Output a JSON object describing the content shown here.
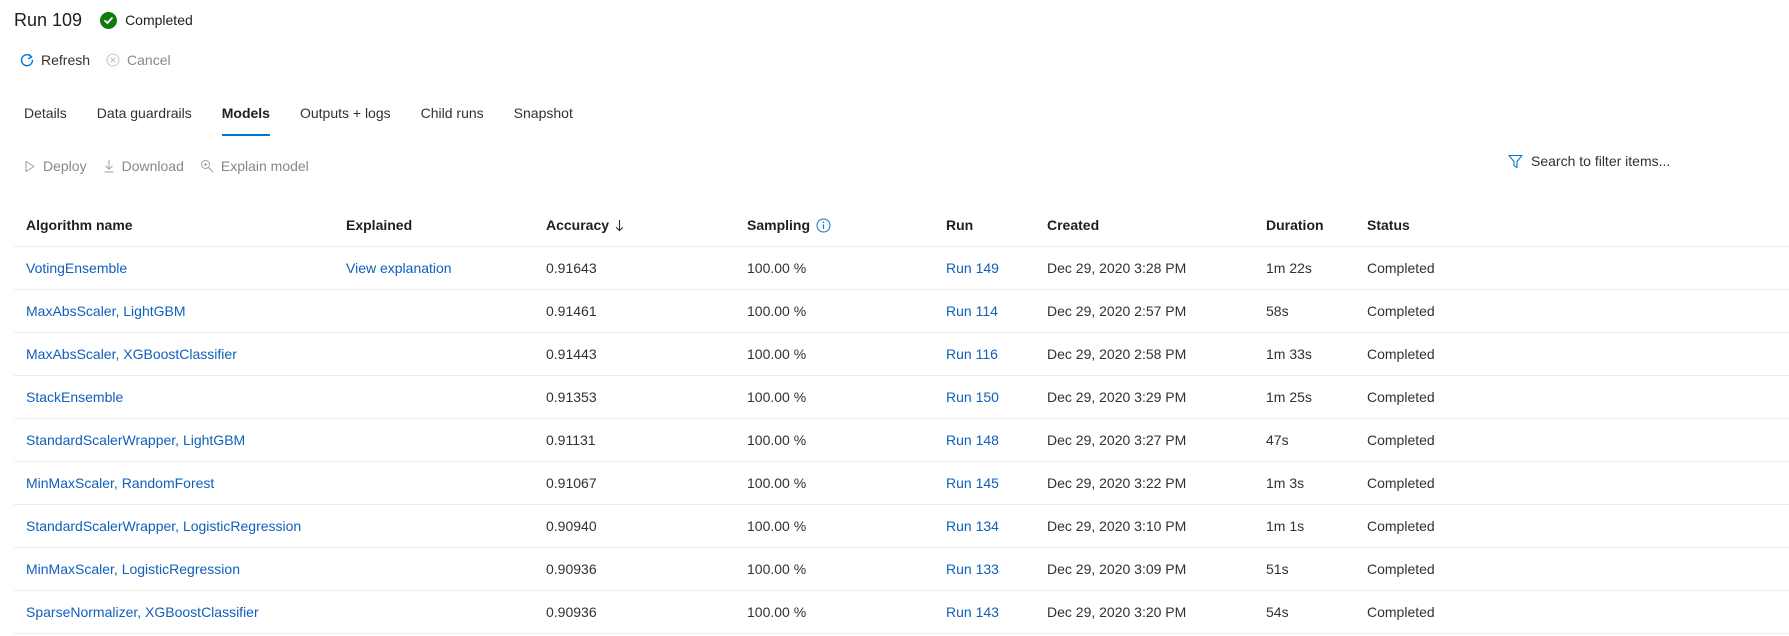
{
  "header": {
    "title": "Run 109",
    "status": "Completed"
  },
  "commands": {
    "refresh": "Refresh",
    "cancel": "Cancel"
  },
  "tabs": [
    {
      "label": "Details",
      "active": false
    },
    {
      "label": "Data guardrails",
      "active": false
    },
    {
      "label": "Models",
      "active": true
    },
    {
      "label": "Outputs + logs",
      "active": false
    },
    {
      "label": "Child runs",
      "active": false
    },
    {
      "label": "Snapshot",
      "active": false
    }
  ],
  "toolbar": {
    "deploy": "Deploy",
    "download": "Download",
    "explain": "Explain model"
  },
  "search": {
    "placeholder": "Search to filter items..."
  },
  "table": {
    "columns": {
      "algorithm": "Algorithm name",
      "explained": "Explained",
      "accuracy": "Accuracy",
      "sampling": "Sampling",
      "run": "Run",
      "created": "Created",
      "duration": "Duration",
      "status": "Status"
    },
    "rows": [
      {
        "algorithm": "VotingEnsemble",
        "explained": "View explanation",
        "accuracy": "0.91643",
        "sampling": "100.00 %",
        "run": "Run 149",
        "created": "Dec 29, 2020 3:28 PM",
        "duration": "1m 22s",
        "status": "Completed"
      },
      {
        "algorithm": "MaxAbsScaler, LightGBM",
        "explained": "",
        "accuracy": "0.91461",
        "sampling": "100.00 %",
        "run": "Run 114",
        "created": "Dec 29, 2020 2:57 PM",
        "duration": "58s",
        "status": "Completed"
      },
      {
        "algorithm": "MaxAbsScaler, XGBoostClassifier",
        "explained": "",
        "accuracy": "0.91443",
        "sampling": "100.00 %",
        "run": "Run 116",
        "created": "Dec 29, 2020 2:58 PM",
        "duration": "1m 33s",
        "status": "Completed"
      },
      {
        "algorithm": "StackEnsemble",
        "explained": "",
        "accuracy": "0.91353",
        "sampling": "100.00 %",
        "run": "Run 150",
        "created": "Dec 29, 2020 3:29 PM",
        "duration": "1m 25s",
        "status": "Completed"
      },
      {
        "algorithm": "StandardScalerWrapper, LightGBM",
        "explained": "",
        "accuracy": "0.91131",
        "sampling": "100.00 %",
        "run": "Run 148",
        "created": "Dec 29, 2020 3:27 PM",
        "duration": "47s",
        "status": "Completed"
      },
      {
        "algorithm": "MinMaxScaler, RandomForest",
        "explained": "",
        "accuracy": "0.91067",
        "sampling": "100.00 %",
        "run": "Run 145",
        "created": "Dec 29, 2020 3:22 PM",
        "duration": "1m 3s",
        "status": "Completed"
      },
      {
        "algorithm": "StandardScalerWrapper, LogisticRegression",
        "explained": "",
        "accuracy": "0.90940",
        "sampling": "100.00 %",
        "run": "Run 134",
        "created": "Dec 29, 2020 3:10 PM",
        "duration": "1m 1s",
        "status": "Completed"
      },
      {
        "algorithm": "MinMaxScaler, LogisticRegression",
        "explained": "",
        "accuracy": "0.90936",
        "sampling": "100.00 %",
        "run": "Run 133",
        "created": "Dec 29, 2020 3:09 PM",
        "duration": "51s",
        "status": "Completed"
      },
      {
        "algorithm": "SparseNormalizer, XGBoostClassifier",
        "explained": "",
        "accuracy": "0.90936",
        "sampling": "100.00 %",
        "run": "Run 143",
        "created": "Dec 29, 2020 3:20 PM",
        "duration": "54s",
        "status": "Completed"
      }
    ]
  },
  "colors": {
    "accent": "#0078d4",
    "link": "#0f5fbd",
    "success": "#107c10",
    "disabled": "#8a8886"
  }
}
